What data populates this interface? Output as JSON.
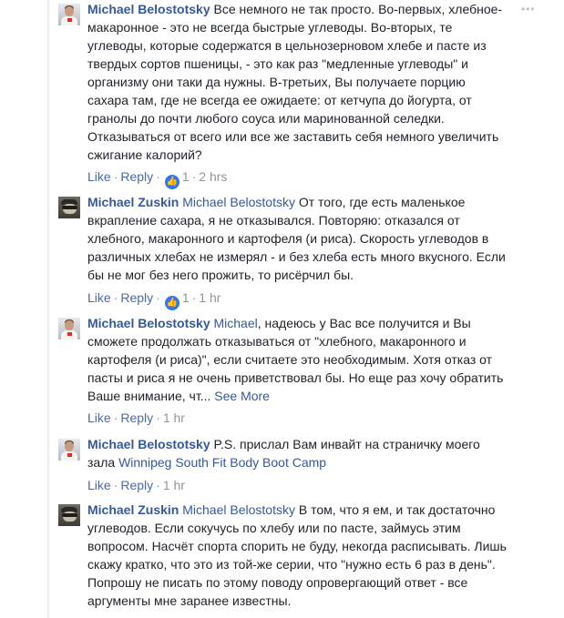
{
  "comments": [
    {
      "author": "Michael Belostotsky",
      "mention": "",
      "text": "Все немного не так просто. Во-первых, хлебное-макаронное - это не всегда быстрые углеводы. Во-вторых, те углеводы, которые содержатся в цельнозерновом хлебе и пасте из твердых сортов пшеницы, - это как раз \"медленные углеводы\" и организму они таки да нужны. В-третьих, Вы получаете порцию сахара там, где не всегда ее ожидаете: от кетчупа до йогурта, от гранолы до почти любого соуса или маринованной селедки. Отказываться от всего или все же заставить себя немного увеличить сжигание калорий?",
      "like": "Like",
      "reply": "Reply",
      "reaction_count": "1",
      "time": "2 hrs"
    },
    {
      "author": "Michael Zuskin",
      "mention": "Michael Belostotsky",
      "text": "От того, где есть маленькое вкрапление сахара, я не отказывался. Повторяю: отказался от хлебного, макаронного и картофеля (и риса). Скорость углеводов в различных хлебах не измерял - и без хлеба есть много вкусного. Если бы не мог без него прожить, то рисёрчил бы.",
      "like": "Like",
      "reply": "Reply",
      "reaction_count": "1",
      "time": "1 hr"
    },
    {
      "author": "Michael Belostotsky",
      "mention": "Michael",
      "text": ", надеюсь у Вас все получится и Вы сможете продолжать отказываться от \"хлебного, макаронного и картофеля (и риса)\", если считаете это необходимым. Хотя отказ от пасты и риса я не очень приветствовал бы. Но еще раз хочу обратить Ваше внимание, чт...",
      "see_more": "See More",
      "like": "Like",
      "reply": "Reply",
      "time": "1 hr"
    },
    {
      "author": "Michael Belostotsky",
      "mention": "",
      "text": "P.S. прислал Вам инвайт на страничку моего зала",
      "link": "Winnipeg South Fit Body Boot Camp",
      "like": "Like",
      "reply": "Reply",
      "time": "1 hr"
    },
    {
      "author": "Michael Zuskin",
      "mention": "Michael Belostotsky",
      "text": "В том, что я ем, и так достаточно углеводов. Если сокучусь по хлебу или по пасте, займусь этим вопросом. Насчёт спорта спорить не буду, некогда расписывать. Лишь скажу кратко, что это из той-же серии, что \"нужно есть 6 раз в день\". Попрошу не писать по этому поводу опровергающий ответ - все аргументы мне заранее известны."
    }
  ],
  "icons": {
    "more": "more-options-icon",
    "reaction": "like-reaction-icon",
    "reaction_color": "#3578e5",
    "link_color": "#365899"
  }
}
